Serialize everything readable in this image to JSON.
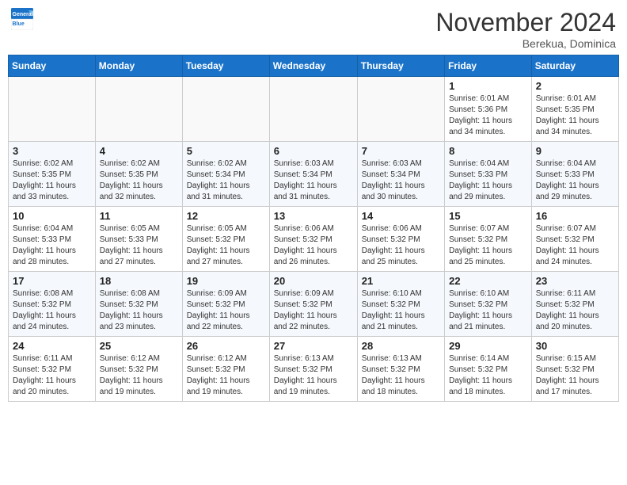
{
  "header": {
    "logo_line1": "General",
    "logo_line2": "Blue",
    "month": "November 2024",
    "location": "Berekua, Dominica"
  },
  "weekdays": [
    "Sunday",
    "Monday",
    "Tuesday",
    "Wednesday",
    "Thursday",
    "Friday",
    "Saturday"
  ],
  "weeks": [
    [
      {
        "day": "",
        "info": ""
      },
      {
        "day": "",
        "info": ""
      },
      {
        "day": "",
        "info": ""
      },
      {
        "day": "",
        "info": ""
      },
      {
        "day": "",
        "info": ""
      },
      {
        "day": "1",
        "info": "Sunrise: 6:01 AM\nSunset: 5:36 PM\nDaylight: 11 hours\nand 34 minutes."
      },
      {
        "day": "2",
        "info": "Sunrise: 6:01 AM\nSunset: 5:35 PM\nDaylight: 11 hours\nand 34 minutes."
      }
    ],
    [
      {
        "day": "3",
        "info": "Sunrise: 6:02 AM\nSunset: 5:35 PM\nDaylight: 11 hours\nand 33 minutes."
      },
      {
        "day": "4",
        "info": "Sunrise: 6:02 AM\nSunset: 5:35 PM\nDaylight: 11 hours\nand 32 minutes."
      },
      {
        "day": "5",
        "info": "Sunrise: 6:02 AM\nSunset: 5:34 PM\nDaylight: 11 hours\nand 31 minutes."
      },
      {
        "day": "6",
        "info": "Sunrise: 6:03 AM\nSunset: 5:34 PM\nDaylight: 11 hours\nand 31 minutes."
      },
      {
        "day": "7",
        "info": "Sunrise: 6:03 AM\nSunset: 5:34 PM\nDaylight: 11 hours\nand 30 minutes."
      },
      {
        "day": "8",
        "info": "Sunrise: 6:04 AM\nSunset: 5:33 PM\nDaylight: 11 hours\nand 29 minutes."
      },
      {
        "day": "9",
        "info": "Sunrise: 6:04 AM\nSunset: 5:33 PM\nDaylight: 11 hours\nand 29 minutes."
      }
    ],
    [
      {
        "day": "10",
        "info": "Sunrise: 6:04 AM\nSunset: 5:33 PM\nDaylight: 11 hours\nand 28 minutes."
      },
      {
        "day": "11",
        "info": "Sunrise: 6:05 AM\nSunset: 5:33 PM\nDaylight: 11 hours\nand 27 minutes."
      },
      {
        "day": "12",
        "info": "Sunrise: 6:05 AM\nSunset: 5:32 PM\nDaylight: 11 hours\nand 27 minutes."
      },
      {
        "day": "13",
        "info": "Sunrise: 6:06 AM\nSunset: 5:32 PM\nDaylight: 11 hours\nand 26 minutes."
      },
      {
        "day": "14",
        "info": "Sunrise: 6:06 AM\nSunset: 5:32 PM\nDaylight: 11 hours\nand 25 minutes."
      },
      {
        "day": "15",
        "info": "Sunrise: 6:07 AM\nSunset: 5:32 PM\nDaylight: 11 hours\nand 25 minutes."
      },
      {
        "day": "16",
        "info": "Sunrise: 6:07 AM\nSunset: 5:32 PM\nDaylight: 11 hours\nand 24 minutes."
      }
    ],
    [
      {
        "day": "17",
        "info": "Sunrise: 6:08 AM\nSunset: 5:32 PM\nDaylight: 11 hours\nand 24 minutes."
      },
      {
        "day": "18",
        "info": "Sunrise: 6:08 AM\nSunset: 5:32 PM\nDaylight: 11 hours\nand 23 minutes."
      },
      {
        "day": "19",
        "info": "Sunrise: 6:09 AM\nSunset: 5:32 PM\nDaylight: 11 hours\nand 22 minutes."
      },
      {
        "day": "20",
        "info": "Sunrise: 6:09 AM\nSunset: 5:32 PM\nDaylight: 11 hours\nand 22 minutes."
      },
      {
        "day": "21",
        "info": "Sunrise: 6:10 AM\nSunset: 5:32 PM\nDaylight: 11 hours\nand 21 minutes."
      },
      {
        "day": "22",
        "info": "Sunrise: 6:10 AM\nSunset: 5:32 PM\nDaylight: 11 hours\nand 21 minutes."
      },
      {
        "day": "23",
        "info": "Sunrise: 6:11 AM\nSunset: 5:32 PM\nDaylight: 11 hours\nand 20 minutes."
      }
    ],
    [
      {
        "day": "24",
        "info": "Sunrise: 6:11 AM\nSunset: 5:32 PM\nDaylight: 11 hours\nand 20 minutes."
      },
      {
        "day": "25",
        "info": "Sunrise: 6:12 AM\nSunset: 5:32 PM\nDaylight: 11 hours\nand 19 minutes."
      },
      {
        "day": "26",
        "info": "Sunrise: 6:12 AM\nSunset: 5:32 PM\nDaylight: 11 hours\nand 19 minutes."
      },
      {
        "day": "27",
        "info": "Sunrise: 6:13 AM\nSunset: 5:32 PM\nDaylight: 11 hours\nand 19 minutes."
      },
      {
        "day": "28",
        "info": "Sunrise: 6:13 AM\nSunset: 5:32 PM\nDaylight: 11 hours\nand 18 minutes."
      },
      {
        "day": "29",
        "info": "Sunrise: 6:14 AM\nSunset: 5:32 PM\nDaylight: 11 hours\nand 18 minutes."
      },
      {
        "day": "30",
        "info": "Sunrise: 6:15 AM\nSunset: 5:32 PM\nDaylight: 11 hours\nand 17 minutes."
      }
    ]
  ]
}
